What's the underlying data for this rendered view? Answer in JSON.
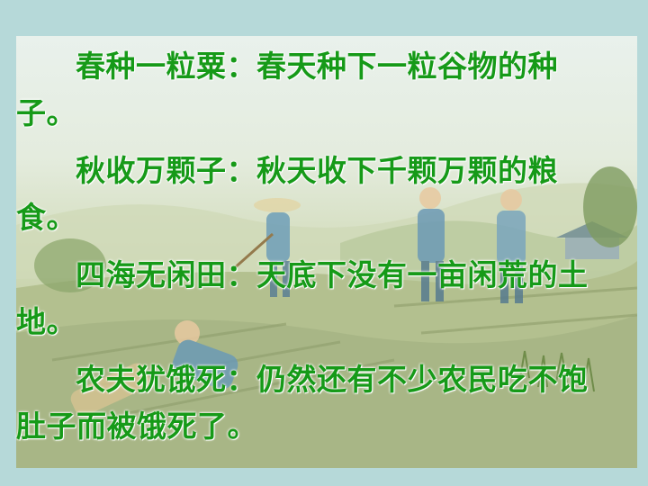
{
  "slide": {
    "paragraphs": [
      "春种一粒粟：春天种下一粒谷物的种子。",
      "秋收万颗子：秋天收下千颗万颗的粮食。",
      "四海无闲田：天底下没有一亩闲荒的土地。",
      "农夫犹饿死：仍然还有不少农民吃不饱肚子而被饿死了。"
    ]
  },
  "colors": {
    "text": "#169a18",
    "border": "#b6d9d9"
  }
}
